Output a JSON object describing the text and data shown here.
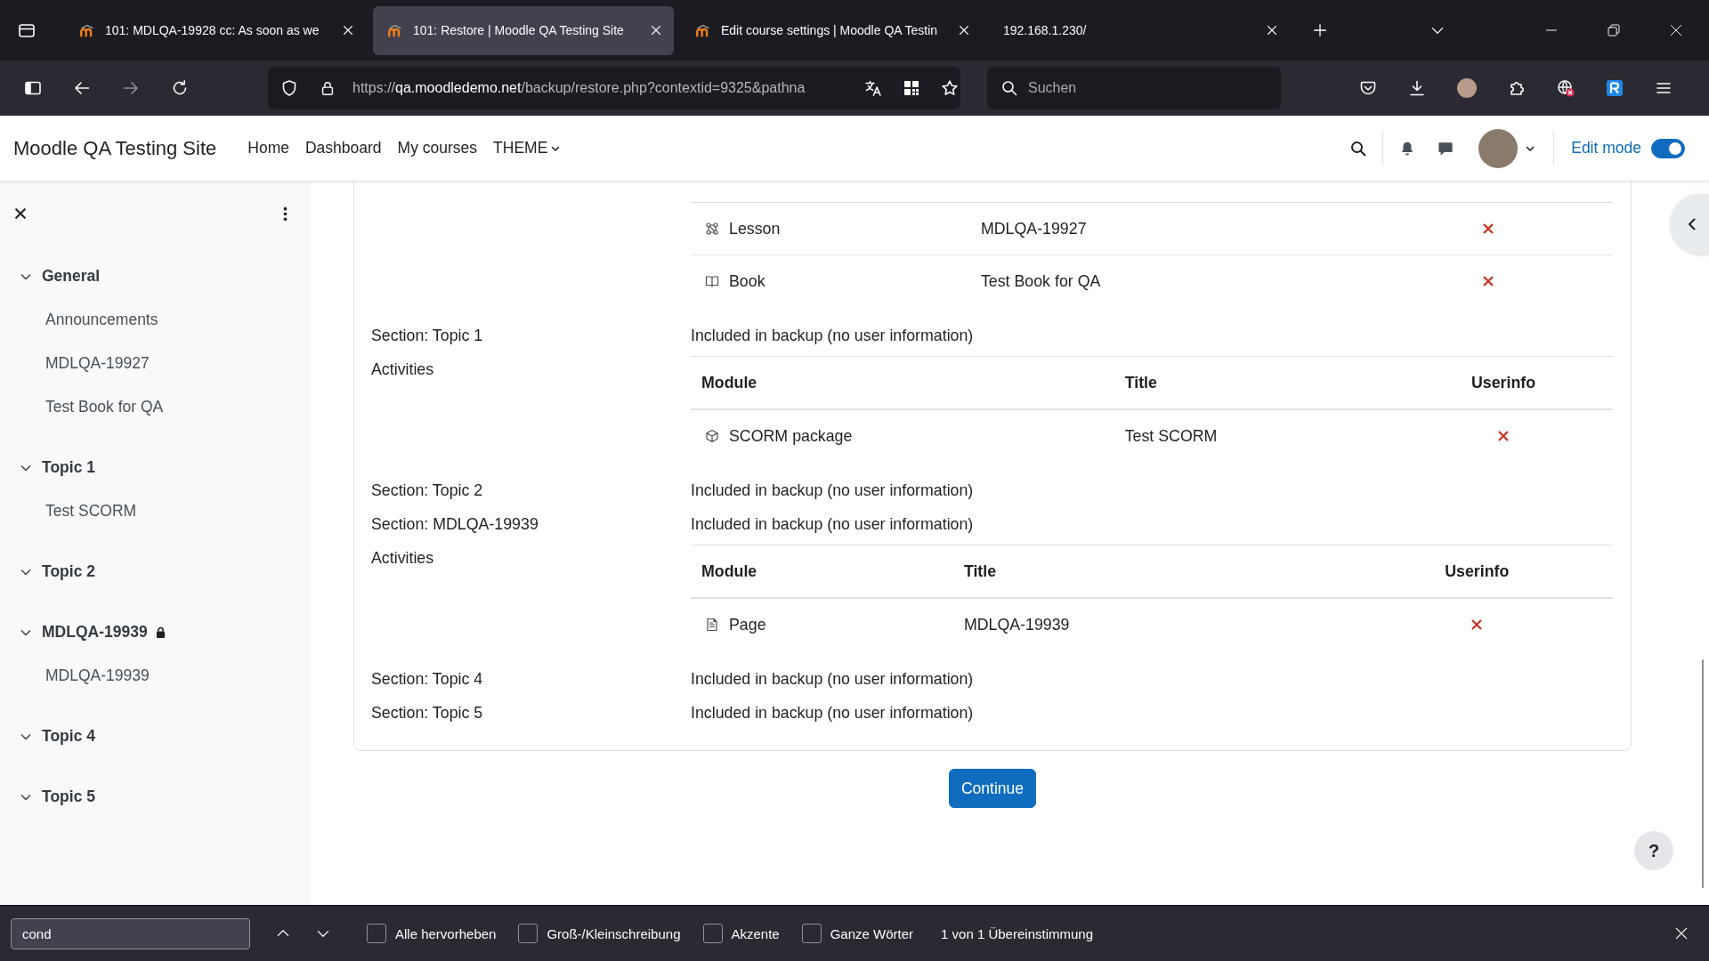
{
  "browser": {
    "tabs": [
      {
        "title": "101: MDLQA-19928 cc: As soon as we",
        "has_icon": true,
        "selected": false
      },
      {
        "title": "101: Restore | Moodle QA Testing Site",
        "has_icon": true,
        "selected": true
      },
      {
        "title": "Edit course settings | Moodle QA Testin",
        "has_icon": true,
        "selected": false
      },
      {
        "title": "192.168.1.230/",
        "has_icon": false,
        "selected": false
      }
    ],
    "forward_disabled": true,
    "url": {
      "scheme": "https://",
      "host": "qa.moodledemo.net",
      "path": "/backup/restore.php?contextid=9325&pathna"
    },
    "search": {
      "placeholder": "Suchen"
    }
  },
  "site": {
    "name": "Moodle QA Testing Site",
    "nav": [
      {
        "label": "Home",
        "kind": "link"
      },
      {
        "label": "Dashboard",
        "kind": "link"
      },
      {
        "label": "My courses",
        "kind": "link"
      },
      {
        "label": "THEME",
        "kind": "dropdown"
      }
    ],
    "edit_mode": {
      "label": "Edit mode",
      "on": true
    }
  },
  "course_index": {
    "sections": [
      {
        "title": "General",
        "expanded": true,
        "restricted": false,
        "children": [
          {
            "title": "Announcements"
          },
          {
            "title": "MDLQA-19927"
          },
          {
            "title": "Test Book for QA"
          }
        ]
      },
      {
        "title": "Topic 1",
        "expanded": true,
        "restricted": false,
        "children": [
          {
            "title": "Test SCORM"
          }
        ]
      },
      {
        "title": "Topic 2",
        "expanded": true,
        "restricted": false
      },
      {
        "title": "MDLQA-19939",
        "expanded": true,
        "restricted": true,
        "children": [
          {
            "title": "MDLQA-19939"
          }
        ]
      },
      {
        "title": "Topic 4",
        "expanded": true,
        "restricted": false
      },
      {
        "title": "Topic 5",
        "expanded": true,
        "restricted": false
      }
    ]
  },
  "backup_details": [
    {
      "kind": "activities",
      "rows": [
        {
          "kind": "lesson",
          "module": "Lesson",
          "title": "MDLQA-19927",
          "userinfo": false
        },
        {
          "kind": "book",
          "module": "Book",
          "title": "Test Book for QA",
          "userinfo": false
        }
      ]
    },
    {
      "kind": "section",
      "label": "Section: Topic 1",
      "value": "Included in backup (no user information)"
    },
    {
      "kind": "activities",
      "label": "Activities",
      "columns": [
        "Module",
        "Title",
        "Userinfo"
      ],
      "rows": [
        {
          "kind": "scorm",
          "module": "SCORM package",
          "title": "Test SCORM",
          "userinfo": false
        }
      ]
    },
    {
      "kind": "section",
      "label": "Section: Topic 2",
      "value": "Included in backup (no user information)"
    },
    {
      "kind": "section",
      "label": "Section: MDLQA-19939",
      "value": "Included in backup (no user information)"
    },
    {
      "kind": "activities",
      "label": "Activities",
      "columns": [
        "Module",
        "Title",
        "Userinfo"
      ],
      "rows": [
        {
          "kind": "page",
          "module": "Page",
          "title": "MDLQA-19939",
          "userinfo": false
        }
      ]
    },
    {
      "kind": "section",
      "label": "Section: Topic 4",
      "value": "Included in backup (no user information)"
    },
    {
      "kind": "section",
      "label": "Section: Topic 5",
      "value": "Included in backup (no user information)"
    }
  ],
  "continue_button": "Continue",
  "help_button": "?",
  "find_bar": {
    "value": "cond",
    "options": [
      {
        "label": "Alle hervorheben",
        "checked": false
      },
      {
        "label": "Groß-/Kleinschreibung",
        "checked": false
      },
      {
        "label": "Akzente",
        "checked": false
      },
      {
        "label": "Ganze Wörter",
        "checked": false
      }
    ],
    "status": "1 von 1 Übereinstimmung"
  }
}
